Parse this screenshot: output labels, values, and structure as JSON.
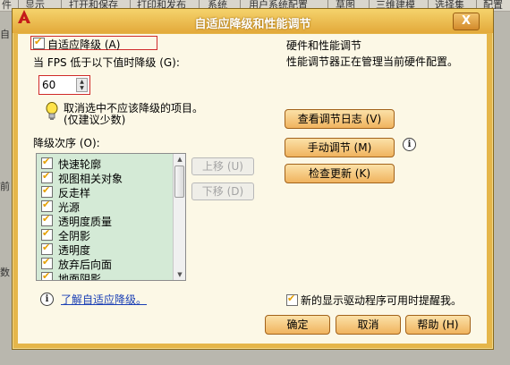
{
  "background": {
    "menu_items": [
      "件",
      "显示",
      "打开和保存",
      "打印和发布",
      "系统",
      "用户系统配置",
      "草图",
      "三维建模",
      "选择集",
      "配置"
    ],
    "left_fragments": [
      "自",
      "前",
      "数"
    ]
  },
  "dialog": {
    "title": "自适应降级和性能调节",
    "close_label": "X",
    "adaptive": {
      "label": "自适应降级 (A)",
      "checked": true,
      "fps_label": "当 FPS 低于以下值时降级 (G):",
      "fps_value": "60",
      "hint_line1": "取消选中不应该降级的项目。",
      "hint_line2": "(仅建议少数)",
      "order_label": "降级次序 (O):",
      "items": [
        {
          "label": "快速轮廓",
          "checked": true
        },
        {
          "label": "视图相关对象",
          "checked": true
        },
        {
          "label": "反走样",
          "checked": true
        },
        {
          "label": "光源",
          "checked": true
        },
        {
          "label": "透明度质量",
          "checked": true
        },
        {
          "label": "全阴影",
          "checked": true
        },
        {
          "label": "透明度",
          "checked": true
        },
        {
          "label": "放弃后向面",
          "checked": true
        },
        {
          "label": "地面阴影",
          "checked": true
        }
      ],
      "move_up": "上移 (U)",
      "move_down": "下移 (D)",
      "learn_link": "了解自适应降级。"
    },
    "hardware": {
      "heading": "硬件和性能调节",
      "status": "性能调节器正在管理当前硬件配置。",
      "view_log": "查看调节日志 (V)",
      "manual_tune": "手动调节 (M)",
      "check_updates": "检查更新 (K)",
      "notify_label": "新的显示驱动程序可用时提醒我。",
      "notify_checked": true
    },
    "buttons": {
      "ok": "确定",
      "cancel": "取消",
      "help": "帮助 (H)"
    }
  }
}
